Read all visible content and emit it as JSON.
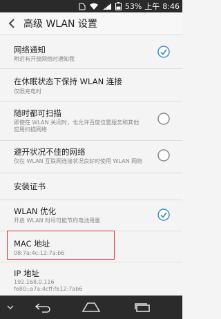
{
  "status": {
    "battery": "53%",
    "time_prefix": "上午",
    "time": "8:46"
  },
  "header": {
    "title": "高级 WLAN 设置"
  },
  "items": [
    {
      "title": "网络通知",
      "subtitle": "附近有开放网络时通知我",
      "control": "checkbox",
      "checked": true
    },
    {
      "title": "在休眠状态下保持 WLAN 连接",
      "subtitle": "仅限充电时"
    },
    {
      "title": "随时都可扫描",
      "subtitle_lines": [
        "即使在 WLAN 关闭时，也允许百度位置服务和其他",
        "应用扫描网络"
      ],
      "control": "radio",
      "checked": false
    },
    {
      "title": "避开状况不佳的网络",
      "subtitle": "仅在 WLAN 互联网连接状况良好时使用 WLAN 网络",
      "control": "radio",
      "checked": false
    },
    {
      "title": "安装证书"
    },
    {
      "title": "WLAN 优化",
      "subtitle": "开启 WLAN 时尽可能节约电池用量",
      "control": "checkbox",
      "checked": true
    },
    {
      "title": "MAC 地址",
      "subtitle": "08:7a:4c:12:7a:b6"
    },
    {
      "title": "IP 地址",
      "subtitle_lines": [
        "192.168.0.116",
        "fe80::a7a:4cff:fe12:7ab6"
      ]
    }
  ],
  "colors": {
    "accent": "#3c8fc4",
    "highlight": "#dd3333",
    "nav_bg": "#2b2b2b",
    "status_bg": "#2a2a2a"
  }
}
